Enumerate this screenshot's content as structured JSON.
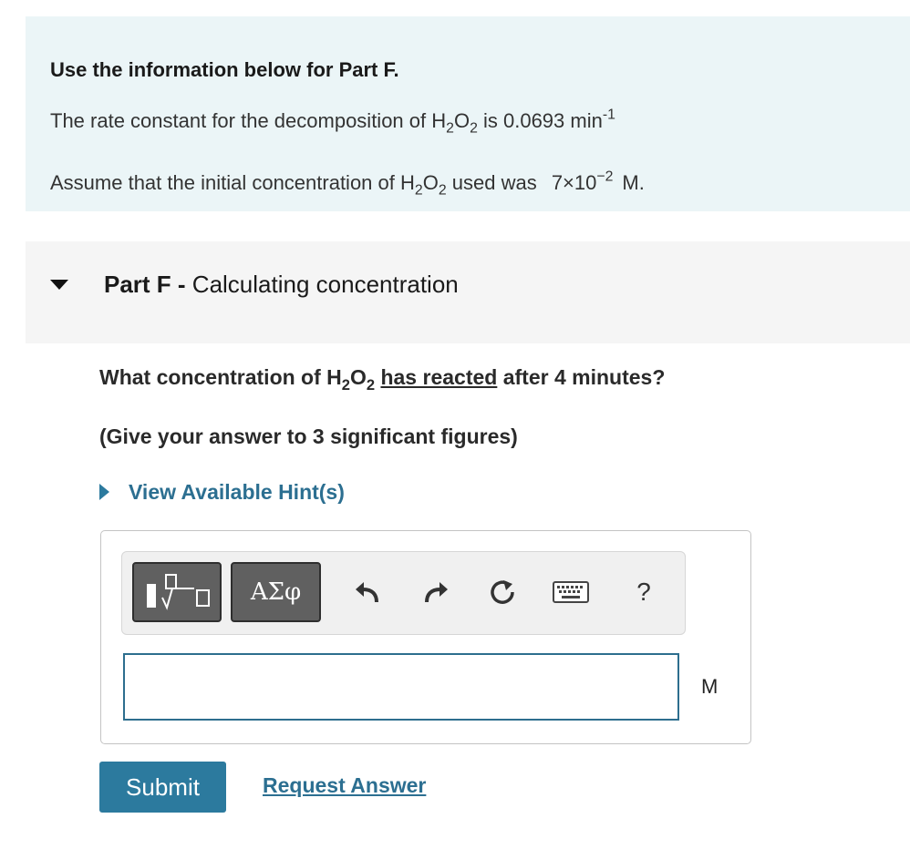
{
  "info": {
    "heading": "Use the information below for Part F.",
    "rate_prefix": "The rate constant for the decomposition of H",
    "rate_h_sub": "2",
    "rate_o": "O",
    "rate_o_sub": "2",
    "rate_mid": " is 0.0693 min",
    "rate_exp": "-1",
    "conc_prefix": "Assume that the initial concentration of H",
    "conc_h_sub": "2",
    "conc_o": "O",
    "conc_o_sub": "2",
    "conc_mid": " used was ",
    "conc_value": "7×10",
    "conc_exp": "−2",
    "conc_unit": "M."
  },
  "part": {
    "label": "Part F",
    "separator": " - ",
    "title": "Calculating concentration"
  },
  "question": {
    "prefix": "What concentration of H",
    "h_sub": "2",
    "o": "O",
    "o_sub": "2",
    "underlined": "has reacted",
    "suffix": " after 4  minutes?"
  },
  "instruction": "(Give your answer to 3 significant figures)",
  "hint_label": "View Available Hint(s)",
  "toolbar": {
    "symbols_label": "ΑΣφ",
    "help_label": "?",
    "icons": [
      "templates-icon",
      "undo-icon",
      "redo-icon",
      "reset-icon",
      "keyboard-icon",
      "help-icon"
    ]
  },
  "answer": {
    "value": "",
    "unit": "M"
  },
  "actions": {
    "submit_label": "Submit",
    "request_label": "Request Answer"
  },
  "colors": {
    "accent": "#2c7a9e",
    "link": "#2c6f91",
    "info_background": "#ebf5f7",
    "part_header_background": "#f5f5f5",
    "tool_button": "#606060"
  }
}
